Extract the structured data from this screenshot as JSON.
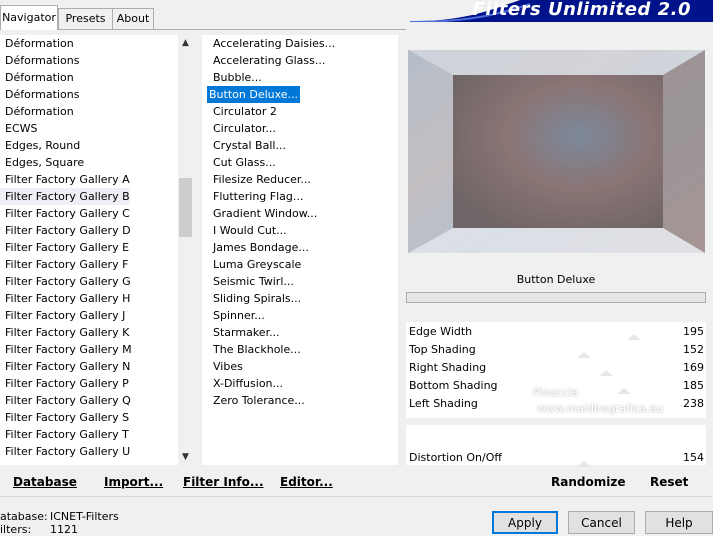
{
  "tabs": [
    "Navigator",
    "Presets",
    "About"
  ],
  "app_title": "Filters Unlimited 2.0",
  "categories": [
    "Déformation",
    "Déformations",
    "Déformation",
    "Déformations",
    "Déformation",
    "ECWS",
    "Edges, Round",
    "Edges, Square",
    "Filter Factory Gallery A",
    "Filter Factory Gallery B",
    "Filter Factory Gallery C",
    "Filter Factory Gallery D",
    "Filter Factory Gallery E",
    "Filter Factory Gallery F",
    "Filter Factory Gallery G",
    "Filter Factory Gallery H",
    "Filter Factory Gallery J",
    "Filter Factory Gallery K",
    "Filter Factory Gallery M",
    "Filter Factory Gallery N",
    "Filter Factory Gallery P",
    "Filter Factory Gallery Q",
    "Filter Factory Gallery S",
    "Filter Factory Gallery T",
    "Filter Factory Gallery U"
  ],
  "selected_category": "Filter Factory Gallery B",
  "filters": [
    "Accelerating Daisies...",
    "Accelerating Glass...",
    "Bubble...",
    "Button Deluxe...",
    "Circulator 2",
    "Circulator...",
    "Crystal Ball...",
    "Cut Glass...",
    "Filesize Reducer...",
    "Fluttering Flag...",
    "Gradient Window...",
    "I Would Cut...",
    "James Bondage...",
    "Luma Greyscale",
    "Seismic Twirl...",
    "Sliding Spirals...",
    "Spinner...",
    "Starmaker...",
    "The Blackhole...",
    "Vibes",
    "X-Diffusion...",
    "Zero Tolerance..."
  ],
  "selected_filter": "Button Deluxe...",
  "filter_name": "Button Deluxe",
  "params": [
    {
      "label": "Edge Width",
      "value": "195"
    },
    {
      "label": "Top Shading",
      "value": "152"
    },
    {
      "label": "Right Shading",
      "value": "169"
    },
    {
      "label": "Bottom Shading",
      "value": "185"
    },
    {
      "label": "Left Shading",
      "value": "238"
    }
  ],
  "distortion": {
    "label": "Distortion On/Off",
    "value": "154"
  },
  "watermark": {
    "name": "Pinuccia",
    "url": "www.maidiregrafica.eu"
  },
  "left_buttons": {
    "database": "Database",
    "import": "Import...",
    "filter_info": "Filter Info...",
    "editor": "Editor..."
  },
  "right_buttons": {
    "randomize": "Randomize",
    "reset": "Reset"
  },
  "status": {
    "database_label": "atabase:",
    "database_value": "ICNET-Filters",
    "filters_label": "ilters:",
    "filters_value": "1121"
  },
  "dialog_buttons": {
    "apply": "Apply",
    "cancel": "Cancel",
    "help": "Help"
  },
  "colors": {
    "selection": "#0078d7",
    "banner": "#00138a"
  }
}
